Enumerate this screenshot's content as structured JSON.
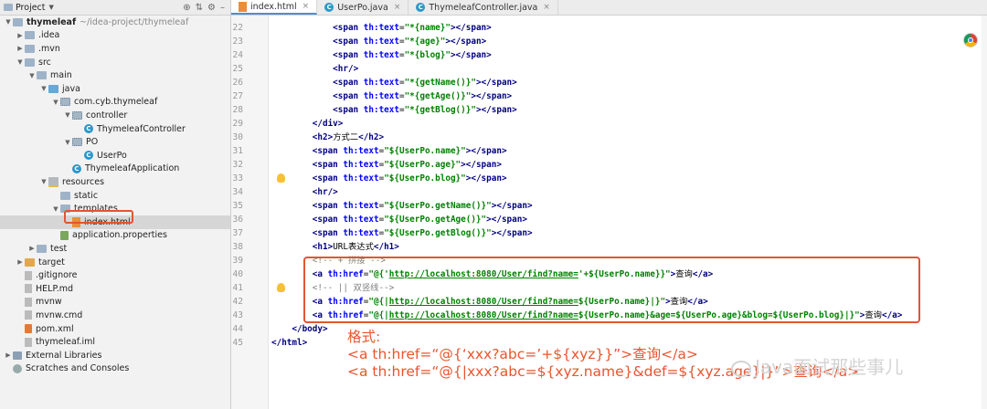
{
  "sidebar": {
    "title": "Project",
    "tree": [
      {
        "label": "thymeleaf",
        "note": "~/idea-project/thymeleaf",
        "depth": 0,
        "arrow": "▼",
        "icon": "folder"
      },
      {
        "label": ".idea",
        "depth": 1,
        "arrow": "▶",
        "icon": "folder"
      },
      {
        "label": ".mvn",
        "depth": 1,
        "arrow": "▶",
        "icon": "folder"
      },
      {
        "label": "src",
        "depth": 1,
        "arrow": "▼",
        "icon": "folder"
      },
      {
        "label": "main",
        "depth": 2,
        "arrow": "▼",
        "icon": "folder"
      },
      {
        "label": "java",
        "depth": 3,
        "arrow": "▼",
        "icon": "folder-blue"
      },
      {
        "label": "com.cyb.thymeleaf",
        "depth": 4,
        "arrow": "▼",
        "icon": "package"
      },
      {
        "label": "controller",
        "depth": 5,
        "arrow": "▼",
        "icon": "package"
      },
      {
        "label": "ThymeleafController",
        "depth": 6,
        "arrow": "",
        "icon": "class"
      },
      {
        "label": "PO",
        "depth": 5,
        "arrow": "▼",
        "icon": "package"
      },
      {
        "label": "UserPo",
        "depth": 6,
        "arrow": "",
        "icon": "class"
      },
      {
        "label": "ThymeleafApplication",
        "depth": 5,
        "arrow": "",
        "icon": "class"
      },
      {
        "label": "resources",
        "depth": 3,
        "arrow": "▼",
        "icon": "resources"
      },
      {
        "label": "static",
        "depth": 4,
        "arrow": "",
        "icon": "folder"
      },
      {
        "label": "templates",
        "depth": 4,
        "arrow": "▼",
        "icon": "folder"
      },
      {
        "label": "index.html",
        "depth": 5,
        "arrow": "",
        "icon": "html",
        "selected": true
      },
      {
        "label": "application.properties",
        "depth": 4,
        "arrow": "",
        "icon": "properties"
      },
      {
        "label": "test",
        "depth": 2,
        "arrow": "▶",
        "icon": "folder"
      },
      {
        "label": "target",
        "depth": 1,
        "arrow": "▶",
        "icon": "folder-orange"
      },
      {
        "label": ".gitignore",
        "depth": 1,
        "arrow": "",
        "icon": "file"
      },
      {
        "label": "HELP.md",
        "depth": 1,
        "arrow": "",
        "icon": "file"
      },
      {
        "label": "mvnw",
        "depth": 1,
        "arrow": "",
        "icon": "file"
      },
      {
        "label": "mvnw.cmd",
        "depth": 1,
        "arrow": "",
        "icon": "file"
      },
      {
        "label": "pom.xml",
        "depth": 1,
        "arrow": "",
        "icon": "xml"
      },
      {
        "label": "thymeleaf.iml",
        "depth": 1,
        "arrow": "",
        "icon": "file"
      },
      {
        "label": "External Libraries",
        "depth": 0,
        "arrow": "▶",
        "icon": "library"
      },
      {
        "label": "Scratches and Consoles",
        "depth": 0,
        "arrow": "",
        "icon": "scratches"
      }
    ]
  },
  "tabs": [
    {
      "label": "index.html",
      "active": true
    },
    {
      "label": "UserPo.java",
      "active": false
    },
    {
      "label": "ThymeleafController.java",
      "active": false
    }
  ],
  "code": {
    "first_line": 22,
    "lines": [
      "            <span th:text=\"*{name}\"></span>",
      "            <span th:text=\"*{age}\"></span>",
      "            <span th:text=\"*{blog}\"></span>",
      "            <hr/>",
      "            <span th:text=\"*{getName()}\"></span>",
      "            <span th:text=\"*{getAge()}\"></span>",
      "            <span th:text=\"*{getBlog()}\"></span>",
      "        </div>",
      "        <h2>方式二</h2>",
      "        <span th:text=\"${UserPo.name}\"></span>",
      "        <span th:text=\"${UserPo.age}\"></span>",
      "        <span th:text=\"${UserPo.blog}\"></span>",
      "        <hr/>",
      "        <span th:text=\"${UserPo.getName()}\"></span>",
      "        <span th:text=\"${UserPo.getAge()}\"></span>",
      "        <span th:text=\"${UserPo.getBlog()}\"></span>",
      "        <h1>URL表达式</h1>",
      "        <!-- + 拼接 -->",
      "        <a th:href=\"@{'http://localhost:8080/User/find?name='+${UserPo.name}}\">查询</a>",
      "        <!-- || 双竖线-->",
      "        <a th:href=\"@{|http://localhost:8080/User/find?name=${UserPo.name}|}\">查询</a>",
      "        <a th:href=\"@{|http://localhost:8080/User/find?name=${UserPo.name}&age=${UserPo.age}&blog=${UserPo.blog}|}\">查询</a>",
      "    </body>",
      "</html>"
    ]
  },
  "annotation": {
    "title": "格式:",
    "line1": "<a th:href=“@{‘xxx?abc=’+${xyz}}”>查询</a>",
    "line2": "<a th:href=“@{|xxx?abc=${xyz.name}&def=${xyz.age}|}”>查询</a>"
  },
  "watermark": "Java面试那些事儿",
  "colors": {
    "highlight_border": "#e05632",
    "annotation_text": "#e8552e"
  }
}
